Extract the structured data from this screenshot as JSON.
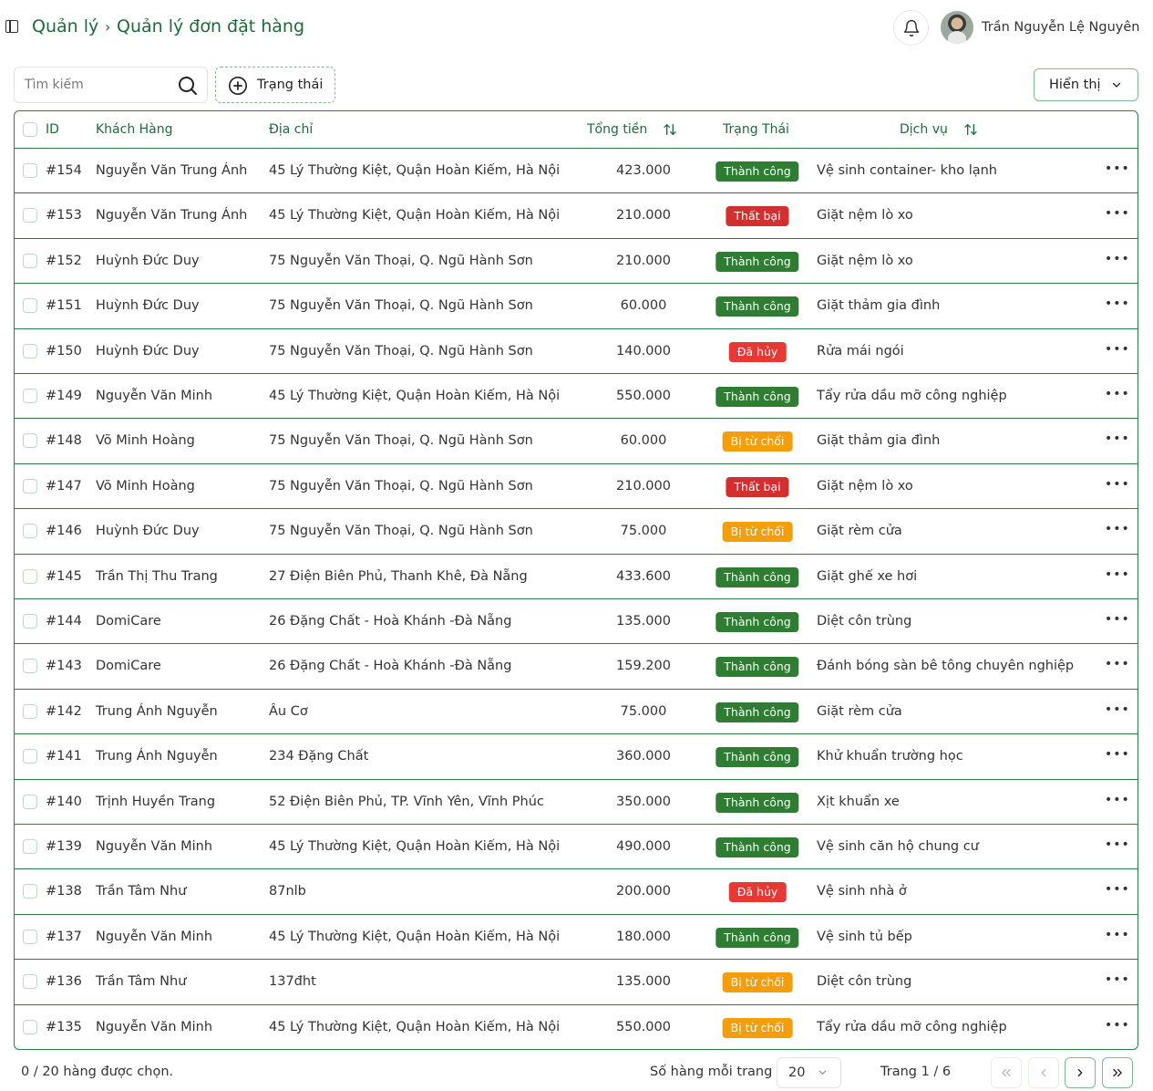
{
  "breadcrumb": {
    "root": "Quản lý",
    "separator": "›",
    "current": "Quản lý đơn đặt hàng"
  },
  "user": {
    "name": "Trần Nguyễn Lệ Nguyên"
  },
  "toolbar": {
    "search_placeholder": "Tìm kiếm",
    "status_filter_label": "Trạng thái",
    "view_label": "Hiển thị"
  },
  "table": {
    "columns": {
      "id": "ID",
      "customer": "Khách Hàng",
      "address": "Địa chỉ",
      "total": "Tổng tiền",
      "status": "Trạng Thái",
      "service": "Dịch vụ"
    },
    "rows": [
      {
        "id": "#154",
        "customer": "Nguyễn Văn Trung Ánh",
        "address": "45 Lý Thường Kiệt, Quận Hoàn Kiếm, Hà Nội",
        "total": "423.000",
        "status": "Thành công",
        "status_type": "success",
        "service": "Vệ sinh container- kho lạnh"
      },
      {
        "id": "#153",
        "customer": "Nguyễn Văn Trung Ánh",
        "address": "45 Lý Thường Kiệt, Quận Hoàn Kiếm, Hà Nội",
        "total": "210.000",
        "status": "Thất bại",
        "status_type": "fail",
        "service": "Giặt nệm lò xo"
      },
      {
        "id": "#152",
        "customer": "Huỳnh Đức Duy",
        "address": "75 Nguyễn Văn Thoại, Q. Ngũ Hành Sơn",
        "total": "210.000",
        "status": "Thành công",
        "status_type": "success",
        "service": "Giặt nệm lò xo"
      },
      {
        "id": "#151",
        "customer": "Huỳnh Đức Duy",
        "address": "75 Nguyễn Văn Thoại, Q. Ngũ Hành Sơn",
        "total": "60.000",
        "status": "Thành công",
        "status_type": "success",
        "service": "Giặt thảm gia đình"
      },
      {
        "id": "#150",
        "customer": "Huỳnh Đức Duy",
        "address": "75 Nguyễn Văn Thoại, Q. Ngũ Hành Sơn",
        "total": "140.000",
        "status": "Đã hủy",
        "status_type": "cancel",
        "service": "Rửa mái ngói"
      },
      {
        "id": "#149",
        "customer": "Nguyễn Văn Minh",
        "address": "45 Lý Thường Kiệt, Quận Hoàn Kiếm, Hà Nội",
        "total": "550.000",
        "status": "Thành công",
        "status_type": "success",
        "service": "Tẩy rửa dầu mỡ công nghiệp"
      },
      {
        "id": "#148",
        "customer": "Võ Minh Hoàng",
        "address": "75 Nguyễn Văn Thoại, Q. Ngũ Hành Sơn",
        "total": "60.000",
        "status": "Bị từ chối",
        "status_type": "reject",
        "service": "Giặt thảm gia đình"
      },
      {
        "id": "#147",
        "customer": "Võ Minh Hoàng",
        "address": "75 Nguyễn Văn Thoại, Q. Ngũ Hành Sơn",
        "total": "210.000",
        "status": "Thất bại",
        "status_type": "fail",
        "service": "Giặt nệm lò xo"
      },
      {
        "id": "#146",
        "customer": "Huỳnh Đức Duy",
        "address": "75 Nguyễn Văn Thoại, Q. Ngũ Hành Sơn",
        "total": "75.000",
        "status": "Bị từ chối",
        "status_type": "reject",
        "service": "Giặt rèm cửa"
      },
      {
        "id": "#145",
        "customer": "Trần Thị Thu Trang",
        "address": "27 Điện Biên Phủ, Thanh Khê, Đà Nẵng",
        "total": "433.600",
        "status": "Thành công",
        "status_type": "success",
        "service": "Giặt ghế xe hơi"
      },
      {
        "id": "#144",
        "customer": "DomiCare",
        "address": "26 Đặng Chất - Hoà Khánh -Đà Nẵng",
        "total": "135.000",
        "status": "Thành công",
        "status_type": "success",
        "service": "Diệt côn trùng"
      },
      {
        "id": "#143",
        "customer": "DomiCare",
        "address": "26 Đặng Chất - Hoà Khánh -Đà Nẵng",
        "total": "159.200",
        "status": "Thành công",
        "status_type": "success",
        "service": "Đánh bóng sàn bê tông chuyên nghiệp"
      },
      {
        "id": "#142",
        "customer": "Trung Ánh Nguyễn",
        "address": "Âu Cơ",
        "total": "75.000",
        "status": "Thành công",
        "status_type": "success",
        "service": "Giặt rèm cửa"
      },
      {
        "id": "#141",
        "customer": "Trung Ánh Nguyễn",
        "address": "234 Đặng Chất",
        "total": "360.000",
        "status": "Thành công",
        "status_type": "success",
        "service": "Khử khuẩn trường học"
      },
      {
        "id": "#140",
        "customer": "Trịnh Huyền Trang",
        "address": "52 Điện Biên Phủ, TP. Vĩnh Yên, Vĩnh Phúc",
        "total": "350.000",
        "status": "Thành công",
        "status_type": "success",
        "service": "Xịt khuẩn xe"
      },
      {
        "id": "#139",
        "customer": "Nguyễn Văn Minh",
        "address": "45 Lý Thường Kiệt, Quận Hoàn Kiếm, Hà Nội",
        "total": "490.000",
        "status": "Thành công",
        "status_type": "success",
        "service": "Vệ sinh căn hộ chung cư"
      },
      {
        "id": "#138",
        "customer": "Trần Tâm Như",
        "address": "87nlb",
        "total": "200.000",
        "status": "Đã hủy",
        "status_type": "cancel",
        "service": "Vệ sinh nhà ở"
      },
      {
        "id": "#137",
        "customer": "Nguyễn Văn Minh",
        "address": "45 Lý Thường Kiệt, Quận Hoàn Kiếm, Hà Nội",
        "total": "180.000",
        "status": "Thành công",
        "status_type": "success",
        "service": "Vệ sinh tủ bếp"
      },
      {
        "id": "#136",
        "customer": "Trần Tâm Như",
        "address": "137đht",
        "total": "135.000",
        "status": "Bị từ chối",
        "status_type": "reject",
        "service": "Diệt côn trùng"
      },
      {
        "id": "#135",
        "customer": "Nguyễn Văn Minh",
        "address": "45 Lý Thường Kiệt, Quận Hoàn Kiếm, Hà Nội",
        "total": "550.000",
        "status": "Bị từ chối",
        "status_type": "reject",
        "service": "Tẩy rửa dầu mỡ công nghiệp"
      }
    ]
  },
  "footer": {
    "selected_info": "0 / 20  hàng được chọn.",
    "rows_per_page_label": "Số hàng mỗi trang",
    "rows_per_page_value": "20",
    "page_info": "Trang 1 / 6"
  },
  "colors": {
    "accent": "#1e6b3a",
    "border": "#2e7d46",
    "success": "#2e7d32",
    "fail": "#d32f2f",
    "cancel": "#e53935",
    "reject": "#f59e0b"
  }
}
